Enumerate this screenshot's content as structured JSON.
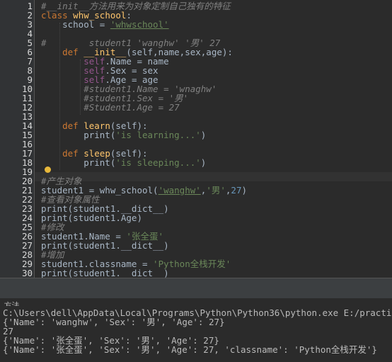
{
  "editor": {
    "line_numbers": [
      "1",
      "2",
      "3",
      "4",
      "5",
      "6",
      "7",
      "8",
      "9",
      "10",
      "11",
      "12",
      "13",
      "14",
      "15",
      "16",
      "17",
      "18",
      "19",
      "20",
      "21",
      "22",
      "23",
      "24",
      "25",
      "26",
      "27",
      "28",
      "29",
      "30",
      "31"
    ],
    "lines": {
      "l1": "#__init__方法用来为对象定制自己独有的特征",
      "l2_kw": "class",
      "l2_name": " whw_school",
      "l2_rest": ":",
      "l3_a": "    school = ",
      "l3_s": "'whwschool'",
      "l5": "#        student1 'wanghw' '男' 27",
      "l6_kw": "    def",
      "l6_fn": " __init__",
      "l6_rest": "(self,name,sex,age):",
      "l7_self": "        self",
      "l7_rest": ".Name = name",
      "l8_self": "        self",
      "l8_rest": ".Sex = sex",
      "l9_self": "        self",
      "l9_rest": ".Age = age",
      "l10": "        #student1.Name = 'wnaghw'",
      "l11": "        #student1.Sex = '男'",
      "l12": "        #Student1.Age = 27",
      "l14_kw": "    def",
      "l14_fn": " learn",
      "l14_rest": "(self):",
      "l15_a": "        print(",
      "l15_s": "'is learning...'",
      "l15_b": ")",
      "l17_kw": "    def",
      "l17_fn": " sleep",
      "l17_rest": "(self):",
      "l18_a": "        print(",
      "l18_s": "'is sleeping...'",
      "l18_b": ")",
      "l20": "#产生对象",
      "l21_a": "student1 = whw_school(",
      "l21_s1": "'wanghw'",
      "l21_c": ",",
      "l21_s2": "'男'",
      "l21_c2": ",",
      "l21_n": "27",
      "l21_b": ")",
      "l22": "#查看对象属性",
      "l23": "print(student1.__dict__)",
      "l24": "print(student1.Age)",
      "l25": "#修改",
      "l26_a": "student1.Name = ",
      "l26_s": "'张全蛋'",
      "l27": "print(student1.__dict__)",
      "l28": "#增加",
      "l29_a": "student1.classname = ",
      "l29_s": "'Python全栈开发'",
      "l30": "print(student1.__dict__)"
    }
  },
  "run_panel": {
    "tab_label": "_方法",
    "command": "C:\\Users\\dell\\AppData\\Local\\Programs\\Python\\Python36\\python.exe E:/practice/",
    "out1": "{'Name': 'wanghw', 'Sex': '男', 'Age': 27}",
    "out2": "27",
    "out3": "{'Name': '张全蛋', 'Sex': '男', 'Age': 27}",
    "out4": "{'Name': '张全蛋', 'Sex': '男', 'Age': 27, 'classname': 'Python全栈开发'}"
  }
}
